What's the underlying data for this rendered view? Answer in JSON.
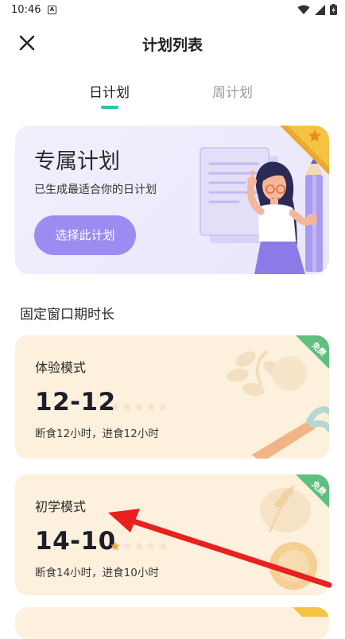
{
  "status_bar": {
    "time": "10:46",
    "notif_letter": "A"
  },
  "header": {
    "title": "计划列表"
  },
  "tabs": [
    {
      "label": "日计划",
      "active": true
    },
    {
      "label": "周计划",
      "active": false
    }
  ],
  "exclusive_plan": {
    "title": "专属计划",
    "subtitle": "已生成最适合你的日计划",
    "button_label": "选择此计划"
  },
  "section_title": "固定窗口期时长",
  "modes": [
    {
      "name": "体验模式",
      "ratio": "12-12",
      "description": "断食12小时，进食12小时",
      "difficulty": 0,
      "max_difficulty": 5,
      "badge": "免费"
    },
    {
      "name": "初学模式",
      "ratio": "14-10",
      "description": "断食14小时，进食10小时",
      "difficulty": 1,
      "max_difficulty": 5,
      "badge": "免费"
    }
  ],
  "colors": {
    "accent": "#2ec4a6",
    "plan_button": "#9b8cf2",
    "mode_card_bg": "#fdf0dc",
    "badge": "#5fbf7f",
    "star_active": "#f2a53a",
    "star_inactive": "#f4e3c8",
    "annotation_arrow": "#e8201e"
  }
}
